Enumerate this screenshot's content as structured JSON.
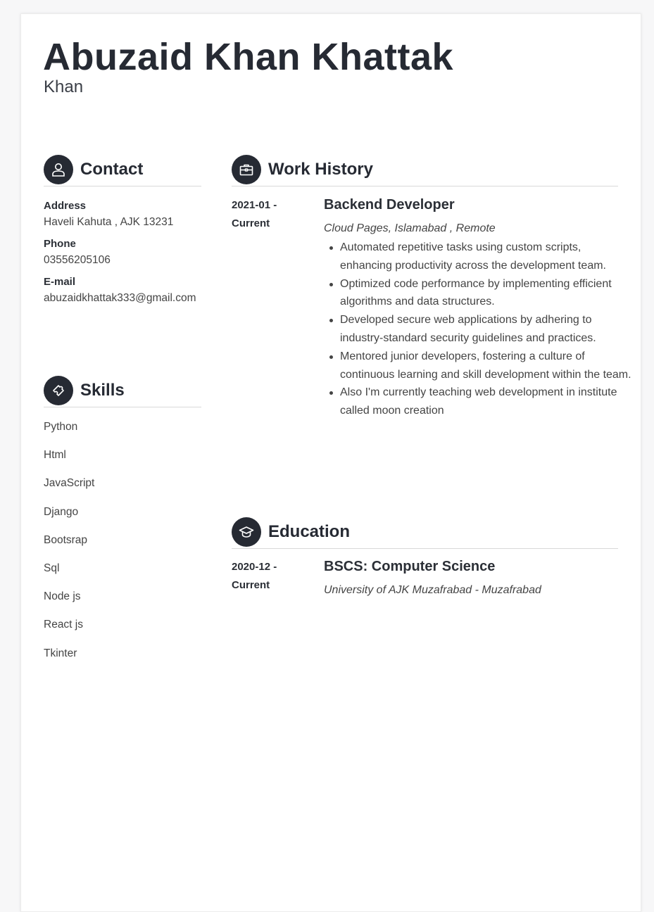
{
  "header": {
    "name": "Abuzaid Khan Khattak",
    "subname": "Khan"
  },
  "contact": {
    "title": "Contact",
    "icon": "person-icon",
    "address_label": "Address",
    "address": "Haveli Kahuta , AJK 13231",
    "phone_label": "Phone",
    "phone": "03556205106",
    "email_label": "E-mail",
    "email": "abuzaidkhattak333@gmail.com"
  },
  "skills": {
    "title": "Skills",
    "icon": "puzzle-icon",
    "items": [
      "Python",
      "Html",
      "JavaScript",
      "Django",
      "Bootsrap",
      "Sql",
      "Node js",
      "React js",
      "Tkinter"
    ]
  },
  "work": {
    "title": "Work History",
    "icon": "briefcase-icon",
    "date_start": "2021-01 -",
    "date_end": "Current",
    "job_title": "Backend Developer",
    "company": "Cloud Pages, Islamabad , Remote",
    "bullets": [
      "Automated repetitive tasks using custom scripts, enhancing productivity across the development team.",
      "Optimized code performance by implementing efficient algorithms and data structures.",
      "Developed secure web applications by adhering to industry-standard security guidelines and practices.",
      "Mentored junior developers, fostering a culture of continuous learning and skill development within the team.",
      "Also I'm currently teaching web development in institute called moon creation"
    ]
  },
  "education": {
    "title": "Education",
    "icon": "graduation-cap-icon",
    "date_start": "2020-12 -",
    "date_end": "Current",
    "degree": "BSCS: Computer Science",
    "school": "University of AJK Muzafrabad - Muzafrabad"
  }
}
